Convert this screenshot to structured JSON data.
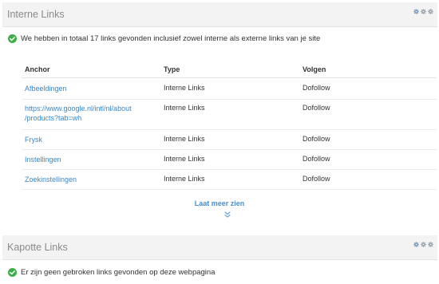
{
  "internal_panel": {
    "title": "Interne Links",
    "status": "We hebben in totaal 17 links gevonden inclusief zowel interne als externe links van je site",
    "columns": {
      "anchor": "Anchor",
      "type": "Type",
      "follow": "Volgen"
    },
    "rows": [
      {
        "anchor": "Afbeeldingen",
        "type": "Interne Links",
        "follow": "Dofollow"
      },
      {
        "anchor_line1": "https://www.google.nl/intl/nl/about",
        "anchor_line2": "/products?tab=wh",
        "type": "Interne Links",
        "follow": "Dofollow"
      },
      {
        "anchor": "Frysk",
        "type": "Interne Links",
        "follow": "Dofollow"
      },
      {
        "anchor": "Instellingen",
        "type": "Interne Links",
        "follow": "Dofollow"
      },
      {
        "anchor": "Zoekinstellingen",
        "type": "Interne Links",
        "follow": "Dofollow"
      }
    ],
    "more_label": "Laat meer zien"
  },
  "broken_panel": {
    "title": "Kapotte Links",
    "status": "Er zijn geen gebroken links gevonden op deze webpagina"
  },
  "colors": {
    "link": "#3a87c8",
    "check": "#3fae49",
    "gear": "#7a9cc0",
    "header_bg": "#f3f3f3"
  },
  "icons": [
    "gear-icon",
    "check-circle-icon",
    "chevron-down-icon"
  ]
}
